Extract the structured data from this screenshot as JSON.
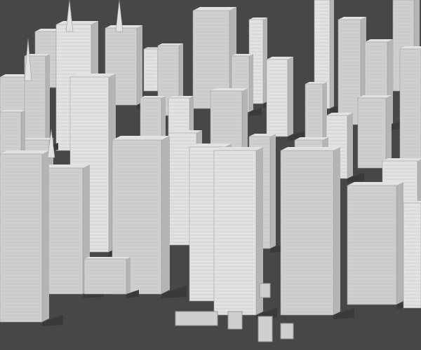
{
  "scene": {
    "subject": "3d-city-model-render",
    "colors": {
      "background": "#474747",
      "building_light": "#e2e2e2",
      "building_mid": "#cfcfcf",
      "building_dark": "#b4b4b4",
      "shadow": "#3a3a3a"
    }
  }
}
